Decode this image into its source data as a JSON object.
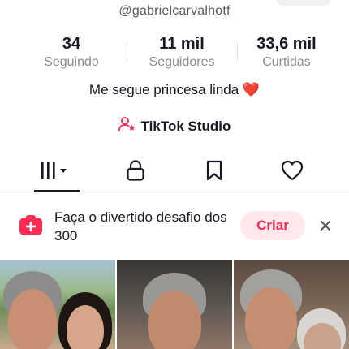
{
  "profile": {
    "username": "@gabrielcarvalhotf",
    "bio_text": "Me segue princesa linda",
    "bio_emoji": "❤️"
  },
  "stats": [
    {
      "value": "34",
      "label": "Seguindo"
    },
    {
      "value": "11 mil",
      "label": "Seguidores"
    },
    {
      "value": "33,6 mil",
      "label": "Curtidas"
    }
  ],
  "studio": {
    "label": "TikTok Studio",
    "icon": "person-star-icon"
  },
  "tabs": [
    {
      "icon": "videos-grid-icon",
      "selected": true
    },
    {
      "icon": "lock-icon",
      "selected": false
    },
    {
      "icon": "bookmark-icon",
      "selected": false
    },
    {
      "icon": "heart-outline-icon",
      "selected": false
    }
  ],
  "promo": {
    "text": "Faça o divertido desafio dos 300",
    "button_label": "Criar",
    "icon": "challenge-plus-icon"
  },
  "colors": {
    "accent": "#fe2c55",
    "accent_bg": "#fde9ec",
    "text_primary": "#161823",
    "text_secondary": "#8a8b91"
  }
}
